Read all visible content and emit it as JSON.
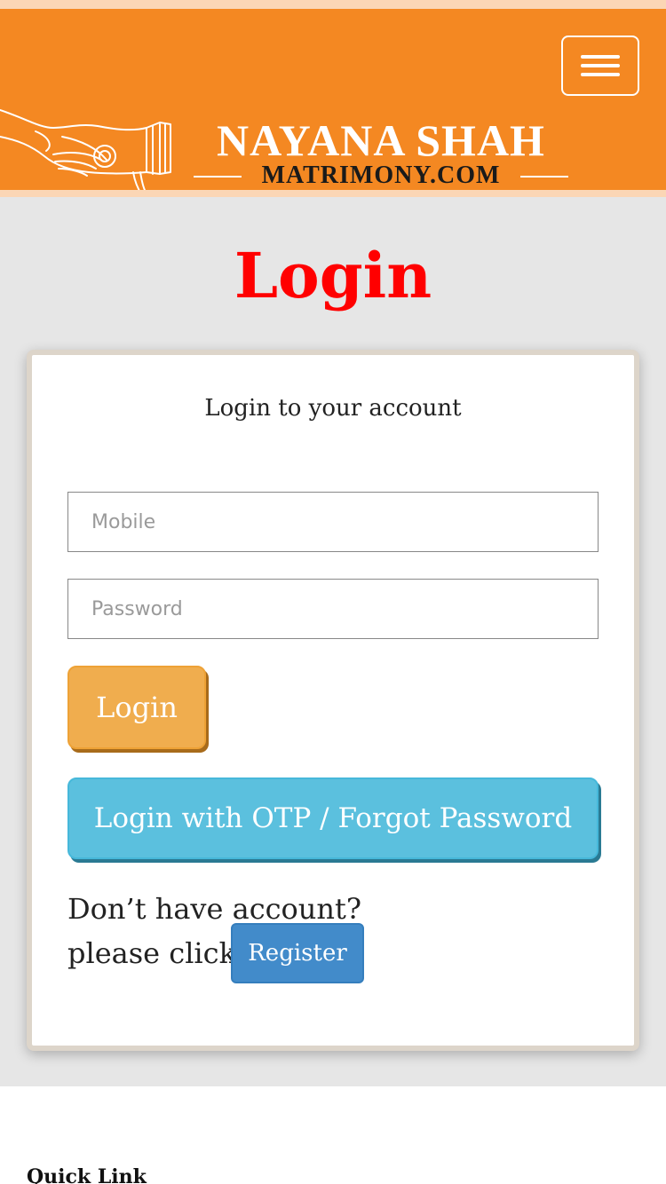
{
  "header": {
    "brand_main": "NAYANA SHAH",
    "brand_sub": "MATRIMONY.COM",
    "menu_icon": "hamburger-menu-icon",
    "logo_icon": "hands-with-bangles-logo",
    "colors": {
      "header_bg": "#f48822",
      "accent_strip": "#fbd6b5"
    }
  },
  "main": {
    "title": "Login",
    "title_color": "#ff0000",
    "card": {
      "heading": "Login to your account",
      "mobile_placeholder": "Mobile",
      "password_placeholder": "Password",
      "login_label": "Login",
      "otp_label": "Login with OTP / Forgot Password",
      "no_account_text": "Don’t have account?",
      "please_click_text": "please click",
      "register_label": "Register"
    }
  },
  "footer": {
    "quick_link_heading": "Quick Link"
  }
}
